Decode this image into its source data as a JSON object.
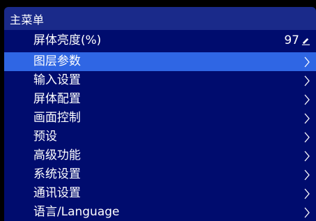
{
  "header": {
    "title": "主菜单"
  },
  "menu": {
    "items": [
      {
        "label": "屏体亮度(%)",
        "value": "97",
        "icon": "edit-icon",
        "selected": false
      },
      {
        "label": "图层参数",
        "icon": "chevron-right-icon",
        "selected": true
      },
      {
        "label": "输入设置",
        "icon": "chevron-right-icon",
        "selected": false
      },
      {
        "label": "屏体配置",
        "icon": "chevron-right-icon",
        "selected": false
      },
      {
        "label": "画面控制",
        "icon": "chevron-right-icon",
        "selected": false
      },
      {
        "label": "预设",
        "icon": "chevron-right-icon",
        "selected": false
      },
      {
        "label": "高级功能",
        "icon": "chevron-right-icon",
        "selected": false
      },
      {
        "label": "系统设置",
        "icon": "chevron-right-icon",
        "selected": false
      },
      {
        "label": "通讯设置",
        "icon": "chevron-right-icon",
        "selected": false
      },
      {
        "label": "语言/Language",
        "icon": "chevron-right-icon",
        "selected": false
      }
    ]
  },
  "colors": {
    "background": "#000000",
    "header": "#1a2a8a",
    "menu": "#000c6e",
    "selected": "#2f66e4",
    "text": "#ffffff"
  }
}
